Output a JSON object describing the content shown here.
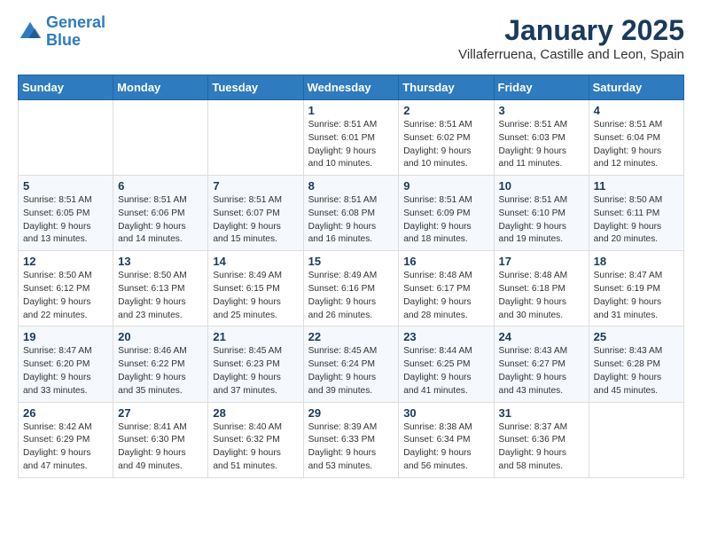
{
  "header": {
    "logo_line1": "General",
    "logo_line2": "Blue",
    "title": "January 2025",
    "subtitle": "Villaferruena, Castille and Leon, Spain"
  },
  "weekdays": [
    "Sunday",
    "Monday",
    "Tuesday",
    "Wednesday",
    "Thursday",
    "Friday",
    "Saturday"
  ],
  "weeks": [
    [
      {
        "day": "",
        "info": ""
      },
      {
        "day": "",
        "info": ""
      },
      {
        "day": "",
        "info": ""
      },
      {
        "day": "1",
        "info": "Sunrise: 8:51 AM\nSunset: 6:01 PM\nDaylight: 9 hours\nand 10 minutes."
      },
      {
        "day": "2",
        "info": "Sunrise: 8:51 AM\nSunset: 6:02 PM\nDaylight: 9 hours\nand 10 minutes."
      },
      {
        "day": "3",
        "info": "Sunrise: 8:51 AM\nSunset: 6:03 PM\nDaylight: 9 hours\nand 11 minutes."
      },
      {
        "day": "4",
        "info": "Sunrise: 8:51 AM\nSunset: 6:04 PM\nDaylight: 9 hours\nand 12 minutes."
      }
    ],
    [
      {
        "day": "5",
        "info": "Sunrise: 8:51 AM\nSunset: 6:05 PM\nDaylight: 9 hours\nand 13 minutes."
      },
      {
        "day": "6",
        "info": "Sunrise: 8:51 AM\nSunset: 6:06 PM\nDaylight: 9 hours\nand 14 minutes."
      },
      {
        "day": "7",
        "info": "Sunrise: 8:51 AM\nSunset: 6:07 PM\nDaylight: 9 hours\nand 15 minutes."
      },
      {
        "day": "8",
        "info": "Sunrise: 8:51 AM\nSunset: 6:08 PM\nDaylight: 9 hours\nand 16 minutes."
      },
      {
        "day": "9",
        "info": "Sunrise: 8:51 AM\nSunset: 6:09 PM\nDaylight: 9 hours\nand 18 minutes."
      },
      {
        "day": "10",
        "info": "Sunrise: 8:51 AM\nSunset: 6:10 PM\nDaylight: 9 hours\nand 19 minutes."
      },
      {
        "day": "11",
        "info": "Sunrise: 8:50 AM\nSunset: 6:11 PM\nDaylight: 9 hours\nand 20 minutes."
      }
    ],
    [
      {
        "day": "12",
        "info": "Sunrise: 8:50 AM\nSunset: 6:12 PM\nDaylight: 9 hours\nand 22 minutes."
      },
      {
        "day": "13",
        "info": "Sunrise: 8:50 AM\nSunset: 6:13 PM\nDaylight: 9 hours\nand 23 minutes."
      },
      {
        "day": "14",
        "info": "Sunrise: 8:49 AM\nSunset: 6:15 PM\nDaylight: 9 hours\nand 25 minutes."
      },
      {
        "day": "15",
        "info": "Sunrise: 8:49 AM\nSunset: 6:16 PM\nDaylight: 9 hours\nand 26 minutes."
      },
      {
        "day": "16",
        "info": "Sunrise: 8:48 AM\nSunset: 6:17 PM\nDaylight: 9 hours\nand 28 minutes."
      },
      {
        "day": "17",
        "info": "Sunrise: 8:48 AM\nSunset: 6:18 PM\nDaylight: 9 hours\nand 30 minutes."
      },
      {
        "day": "18",
        "info": "Sunrise: 8:47 AM\nSunset: 6:19 PM\nDaylight: 9 hours\nand 31 minutes."
      }
    ],
    [
      {
        "day": "19",
        "info": "Sunrise: 8:47 AM\nSunset: 6:20 PM\nDaylight: 9 hours\nand 33 minutes."
      },
      {
        "day": "20",
        "info": "Sunrise: 8:46 AM\nSunset: 6:22 PM\nDaylight: 9 hours\nand 35 minutes."
      },
      {
        "day": "21",
        "info": "Sunrise: 8:45 AM\nSunset: 6:23 PM\nDaylight: 9 hours\nand 37 minutes."
      },
      {
        "day": "22",
        "info": "Sunrise: 8:45 AM\nSunset: 6:24 PM\nDaylight: 9 hours\nand 39 minutes."
      },
      {
        "day": "23",
        "info": "Sunrise: 8:44 AM\nSunset: 6:25 PM\nDaylight: 9 hours\nand 41 minutes."
      },
      {
        "day": "24",
        "info": "Sunrise: 8:43 AM\nSunset: 6:27 PM\nDaylight: 9 hours\nand 43 minutes."
      },
      {
        "day": "25",
        "info": "Sunrise: 8:43 AM\nSunset: 6:28 PM\nDaylight: 9 hours\nand 45 minutes."
      }
    ],
    [
      {
        "day": "26",
        "info": "Sunrise: 8:42 AM\nSunset: 6:29 PM\nDaylight: 9 hours\nand 47 minutes."
      },
      {
        "day": "27",
        "info": "Sunrise: 8:41 AM\nSunset: 6:30 PM\nDaylight: 9 hours\nand 49 minutes."
      },
      {
        "day": "28",
        "info": "Sunrise: 8:40 AM\nSunset: 6:32 PM\nDaylight: 9 hours\nand 51 minutes."
      },
      {
        "day": "29",
        "info": "Sunrise: 8:39 AM\nSunset: 6:33 PM\nDaylight: 9 hours\nand 53 minutes."
      },
      {
        "day": "30",
        "info": "Sunrise: 8:38 AM\nSunset: 6:34 PM\nDaylight: 9 hours\nand 56 minutes."
      },
      {
        "day": "31",
        "info": "Sunrise: 8:37 AM\nSunset: 6:36 PM\nDaylight: 9 hours\nand 58 minutes."
      },
      {
        "day": "",
        "info": ""
      }
    ]
  ]
}
